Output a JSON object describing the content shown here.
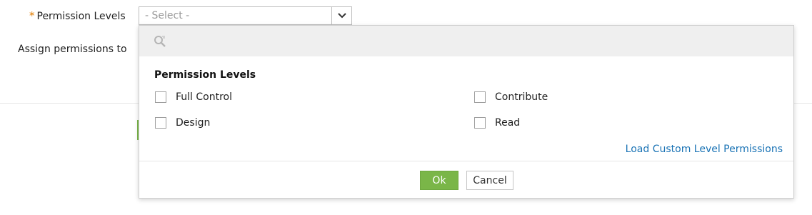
{
  "form": {
    "permission_levels_label": "Permission Levels",
    "required_marker": "*",
    "assign_permissions_label": "Assign permissions to"
  },
  "select": {
    "placeholder": "- Select -",
    "arrow_icon": "chevron-down-icon"
  },
  "dropdown": {
    "search_icon": "search-icon",
    "search_value": "",
    "group_title": "Permission Levels",
    "options": [
      {
        "label": "Full Control",
        "checked": false
      },
      {
        "label": "Contribute",
        "checked": false
      },
      {
        "label": "Design",
        "checked": false
      },
      {
        "label": "Read",
        "checked": false
      }
    ],
    "load_custom_label": "Load Custom Level Permissions",
    "ok_label": "Ok",
    "cancel_label": "Cancel"
  },
  "colors": {
    "accent_green": "#7ab648",
    "link_blue": "#1a73b5",
    "required_orange": "#e07b00"
  }
}
